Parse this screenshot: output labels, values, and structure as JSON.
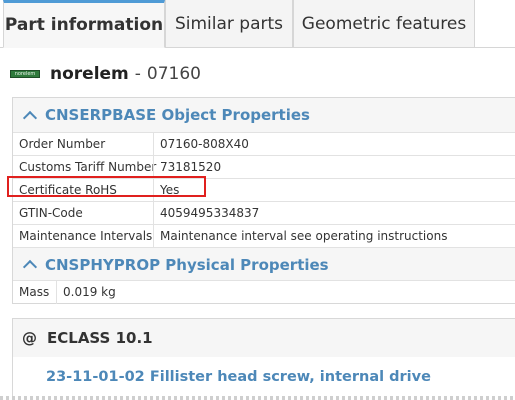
{
  "tabs": [
    {
      "label": "Part information",
      "active": true
    },
    {
      "label": "Similar parts",
      "active": false
    },
    {
      "label": "Geometric features",
      "active": false
    }
  ],
  "header": {
    "logo_text": "norelem",
    "brand": "norelem",
    "separator": "-",
    "part_number": "07160"
  },
  "sections": [
    {
      "title": "CNSERPBASE Object Properties",
      "rows": [
        {
          "key": "Order Number",
          "value": "07160-808X40"
        },
        {
          "key": "Customs Tariff Number",
          "value": "73181520"
        },
        {
          "key": "Certificate RoHS",
          "value": "Yes"
        },
        {
          "key": "GTIN-Code",
          "value": "4059495334837"
        },
        {
          "key": "Maintenance Intervals",
          "value": "Maintenance interval see operating instructions"
        }
      ]
    },
    {
      "title": "CNSPHYPROP Physical Properties",
      "rows": [
        {
          "key": "Mass",
          "value": "0.019 kg"
        }
      ]
    }
  ],
  "eclass": {
    "title": "ECLASS 10.1",
    "link": "23-11-01-02 Fillister head screw, internal drive"
  },
  "colors": {
    "accent": "#4d88b8",
    "highlight": "#e0201e",
    "logo": "#2f7a3c"
  }
}
